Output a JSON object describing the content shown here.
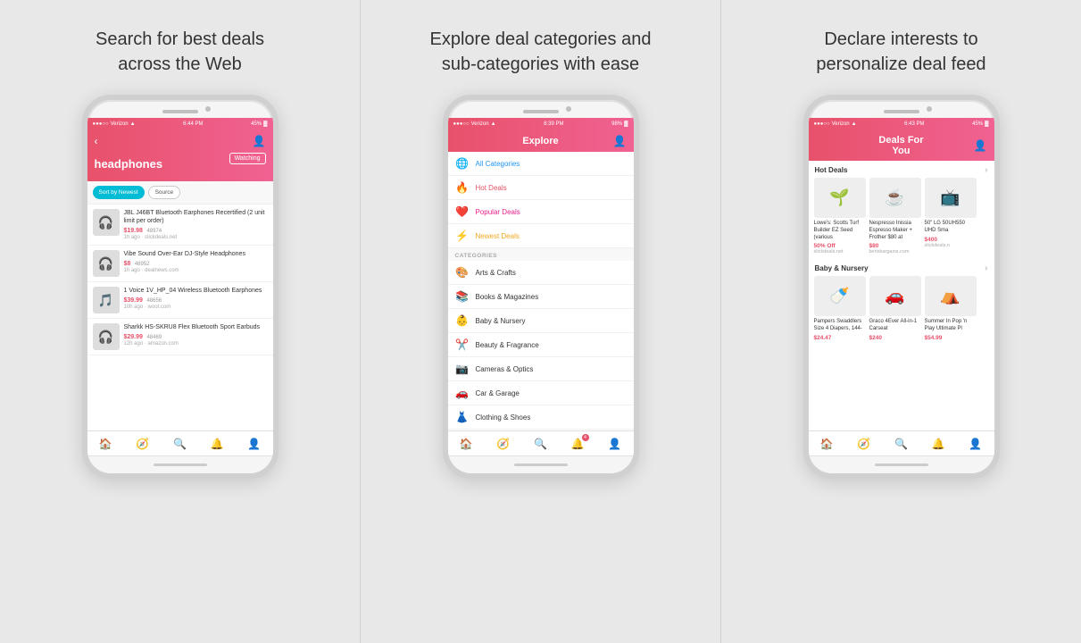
{
  "panels": [
    {
      "id": "search",
      "title": "Search for best deals\nacross the Web",
      "phone": {
        "time": "6:44 PM",
        "carrier": "Verizon",
        "battery": "45%",
        "header": {
          "back": true,
          "search_term": "headphones",
          "watching_label": "Watching"
        },
        "filters": [
          "Sort by Newest",
          "Source"
        ],
        "deals": [
          {
            "emoji": "🎧",
            "title": "JBL J46BT Bluetooth Earphones Recertified (2 unit limit per order)",
            "price": "$19.98",
            "count": "48974",
            "time": "1h ago",
            "source": "slickdeals.net"
          },
          {
            "emoji": "🎧",
            "title": "Vibe Sound Over-Ear DJ-Style Headphones",
            "price": "$8",
            "count": "48952",
            "time": "1h ago",
            "source": "dealnews.com"
          },
          {
            "emoji": "🎵",
            "title": "1 Voice 1V_HP_04 Wireless Bluetooth Earphones",
            "price": "$39.99",
            "count": "48656",
            "time": "10h ago",
            "source": "woot.com"
          },
          {
            "emoji": "🎧",
            "title": "Sharkk HS-SKRU8 Flex Bluetooth Sport Earbuds",
            "price": "$29.99",
            "count": "48469",
            "time": "12h ago",
            "source": "amazon.com"
          }
        ],
        "tabs": [
          {
            "icon": "🏠",
            "active": false
          },
          {
            "icon": "🧭",
            "active": false
          },
          {
            "icon": "🔍",
            "active": true
          },
          {
            "icon": "🔔",
            "active": false
          },
          {
            "icon": "👤",
            "active": false
          }
        ]
      }
    },
    {
      "id": "explore",
      "title": "Explore deal categories and\nsub-categories with ease",
      "phone": {
        "time": "8:39 PM",
        "carrier": "Verizon",
        "battery": "98%",
        "header": {
          "title": "Explore"
        },
        "featured": [
          {
            "label": "All Categories",
            "icon": "🌐",
            "type": "all"
          },
          {
            "label": "Hot Deals",
            "icon": "🔥",
            "type": "hot"
          },
          {
            "label": "Popular Deals",
            "icon": "❤️",
            "type": "popular"
          },
          {
            "label": "Newest Deals",
            "icon": "⚡",
            "type": "newest"
          }
        ],
        "categories_label": "CATEGORIES",
        "categories": [
          {
            "label": "Arts & Crafts",
            "icon": "🎨"
          },
          {
            "label": "Books & Magazines",
            "icon": "📚"
          },
          {
            "label": "Baby & Nursery",
            "icon": "👶"
          },
          {
            "label": "Beauty & Fragrance",
            "icon": "✂️"
          },
          {
            "label": "Cameras & Optics",
            "icon": "📷"
          },
          {
            "label": "Car & Garage",
            "icon": "🚗"
          },
          {
            "label": "Clothing & Shoes",
            "icon": "👗"
          }
        ],
        "tabs": [
          {
            "icon": "🏠",
            "active": false
          },
          {
            "icon": "🧭",
            "active": true
          },
          {
            "icon": "🔍",
            "active": false
          },
          {
            "icon": "🔔",
            "active": false,
            "badge": "4"
          },
          {
            "icon": "👤",
            "active": false
          }
        ]
      }
    },
    {
      "id": "deals-for-you",
      "title": "Declare interests to\npersonalize deal feed",
      "phone": {
        "time": "6:43 PM",
        "carrier": "Verizon",
        "battery": "45%",
        "header": {
          "title": "Deals For You"
        },
        "sections": [
          {
            "title": "Hot Deals",
            "products": [
              {
                "emoji": "🌱",
                "name": "Lowe's: Scotts Turf Builder EZ Seed (various",
                "price": "50% Off",
                "source": "slickdeals.net"
              },
              {
                "emoji": "☕",
                "name": "Nespresso Inissia Espresso Maker + Frother $80 at",
                "price": "$80",
                "source": "bensbargains.com"
              },
              {
                "emoji": "📺",
                "name": "50\" LG 50UH550 UHD Sma",
                "price": "$400",
                "source": "slickdeals.n"
              }
            ]
          },
          {
            "title": "Baby & Nursery",
            "products": [
              {
                "emoji": "🍼",
                "name": "Pampers Swaddlers Size 4 Diapers, 144-",
                "price": "$24.47",
                "source": ""
              },
              {
                "emoji": "🚗",
                "name": "Graco 4Ever All-in-1 Carseat",
                "price": "$240",
                "source": ""
              },
              {
                "emoji": "⛺",
                "name": "Summer In Pop 'n Play Ultimate Pl",
                "price": "$54.99",
                "source": ""
              }
            ]
          }
        ],
        "tabs": [
          {
            "icon": "🏠",
            "active": true
          },
          {
            "icon": "🧭",
            "active": false
          },
          {
            "icon": "🔍",
            "active": false
          },
          {
            "icon": "🔔",
            "active": false
          },
          {
            "icon": "👤",
            "active": false
          }
        ]
      }
    }
  ]
}
